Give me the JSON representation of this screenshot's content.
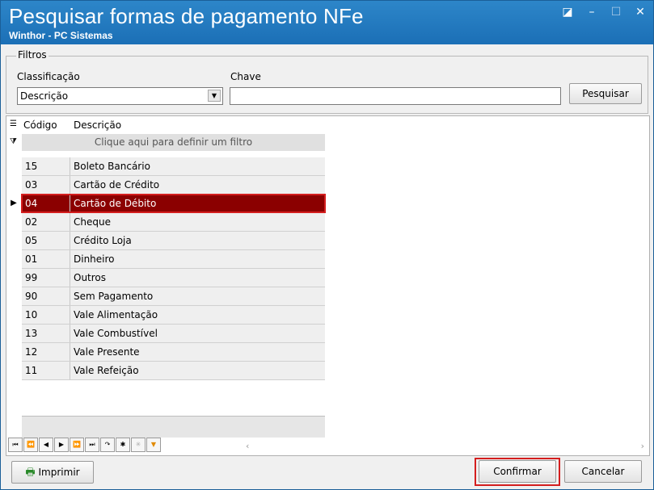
{
  "window": {
    "title": "Pesquisar formas de pagamento NFe",
    "subtitle": "Winthor - PC Sistemas"
  },
  "filters": {
    "group_label": "Filtros",
    "classificacao_label": "Classificação",
    "classificacao_value": "Descrição",
    "chave_label": "Chave",
    "chave_value": "",
    "search_button": "Pesquisar"
  },
  "grid": {
    "columns": [
      "Código",
      "Descrição"
    ],
    "filter_hint": "Clique aqui para definir um filtro",
    "rows": [
      {
        "codigo": "15",
        "descricao": "Boleto Bancário"
      },
      {
        "codigo": "03",
        "descricao": "Cartão de Crédito"
      },
      {
        "codigo": "04",
        "descricao": "Cartão de Débito"
      },
      {
        "codigo": "02",
        "descricao": "Cheque"
      },
      {
        "codigo": "05",
        "descricao": "Crédito Loja"
      },
      {
        "codigo": "01",
        "descricao": "Dinheiro"
      },
      {
        "codigo": "99",
        "descricao": "Outros"
      },
      {
        "codigo": "90",
        "descricao": "Sem Pagamento"
      },
      {
        "codigo": "10",
        "descricao": "Vale Alimentação"
      },
      {
        "codigo": "13",
        "descricao": "Vale Combustível"
      },
      {
        "codigo": "12",
        "descricao": "Vale Presente"
      },
      {
        "codigo": "11",
        "descricao": "Vale Refeição"
      }
    ],
    "selected_index": 2
  },
  "buttons": {
    "print": "Imprimir",
    "confirm": "Confirmar",
    "cancel": "Cancelar"
  },
  "colors": {
    "title_bar": "#1b6fb6",
    "selected_row": "#8b0000",
    "highlight_outline": "#d41e1e"
  }
}
